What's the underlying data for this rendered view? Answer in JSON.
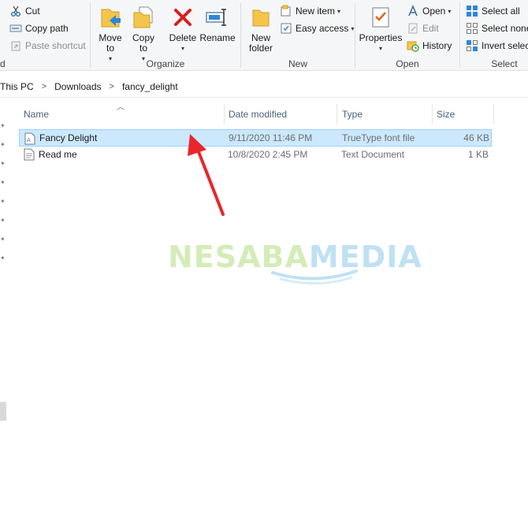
{
  "ribbon": {
    "clipboard": {
      "cut": "Cut",
      "copy_path": "Copy path",
      "paste_shortcut": "Paste shortcut",
      "group_label_partial": "d"
    },
    "organize": {
      "move_to": "Move to",
      "copy_to": "Copy to",
      "delete": "Delete",
      "rename": "Rename",
      "group_label": "Organize"
    },
    "new": {
      "new_folder_line1": "New",
      "new_folder_line2": "folder",
      "new_item": "New item",
      "easy_access": "Easy access",
      "group_label": "New"
    },
    "open": {
      "properties": "Properties",
      "open": "Open",
      "edit": "Edit",
      "history": "History",
      "group_label": "Open"
    },
    "select": {
      "select_all": "Select all",
      "select_none": "Select none",
      "invert_selection": "Invert select",
      "group_label": "Select"
    }
  },
  "address": {
    "crumbs": [
      "This PC",
      "Downloads",
      "fancy_delight"
    ],
    "separator": ">"
  },
  "columns": {
    "name": "Name",
    "date_modified": "Date modified",
    "type": "Type",
    "size": "Size"
  },
  "files": [
    {
      "name": "Fancy Delight",
      "date": "9/11/2020 11:46 PM",
      "type": "TrueType font file",
      "size": "46 KB",
      "selected": true
    },
    {
      "name": "Read me",
      "date": "10/8/2020 2:45 PM",
      "type": "Text Document",
      "size": "1 KB",
      "selected": false
    }
  ],
  "watermark": {
    "part1": "NESABA",
    "part2": "MEDIA"
  },
  "colors": {
    "selection_bg": "#cce8ff",
    "selection_border": "#99d1ff",
    "annotation_arrow": "#e8262b",
    "delete_icon": "#d81e1e"
  }
}
